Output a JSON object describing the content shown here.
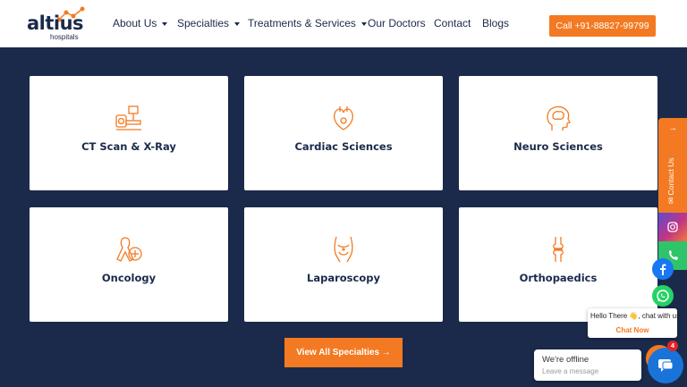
{
  "header": {
    "logo": {
      "name": "altius",
      "sub": "hospitals"
    },
    "nav": [
      {
        "label": "About Us",
        "dropdown": true
      },
      {
        "label": "Specialties",
        "dropdown": true
      },
      {
        "label": "Treatments & Services",
        "dropdown": true
      },
      {
        "label": "Our Doctors",
        "dropdown": false
      },
      {
        "label": "Contact",
        "dropdown": false
      },
      {
        "label": "Blogs",
        "dropdown": false
      }
    ],
    "call_button": "Call +91-88827-99799"
  },
  "specialties": [
    {
      "label": "CT Scan & X-Ray",
      "icon": "ct-scanner-icon"
    },
    {
      "label": "Cardiac Sciences",
      "icon": "heart-icon"
    },
    {
      "label": "Neuro Sciences",
      "icon": "brain-head-icon"
    },
    {
      "label": "Oncology",
      "icon": "cancer-ribbon-icon"
    },
    {
      "label": "Laparoscopy",
      "icon": "abdomen-icon"
    },
    {
      "label": "Orthopaedics",
      "icon": "bone-joint-icon"
    }
  ],
  "view_all": {
    "label": "View All Specialties",
    "icon": "arrow-right-icon"
  },
  "side_bar": {
    "contact_label": "Contact Us",
    "contact_icons": [
      "arrow-right-icon",
      "email-icon"
    ],
    "instagram_icon": "instagram-icon",
    "phone_icon": "phone-icon"
  },
  "floating": {
    "facebook_icon": "facebook-icon",
    "whatsapp_icon": "whatsapp-icon",
    "chat_hello": "Hello There 👋, chat with us",
    "chat_now": "Chat Now",
    "offline_title": "We're offline",
    "offline_sub": "Leave a message",
    "badge_count": "4"
  },
  "colors": {
    "navy": "#1b2a4b",
    "orange": "#f37a22",
    "white": "#ffffff"
  }
}
